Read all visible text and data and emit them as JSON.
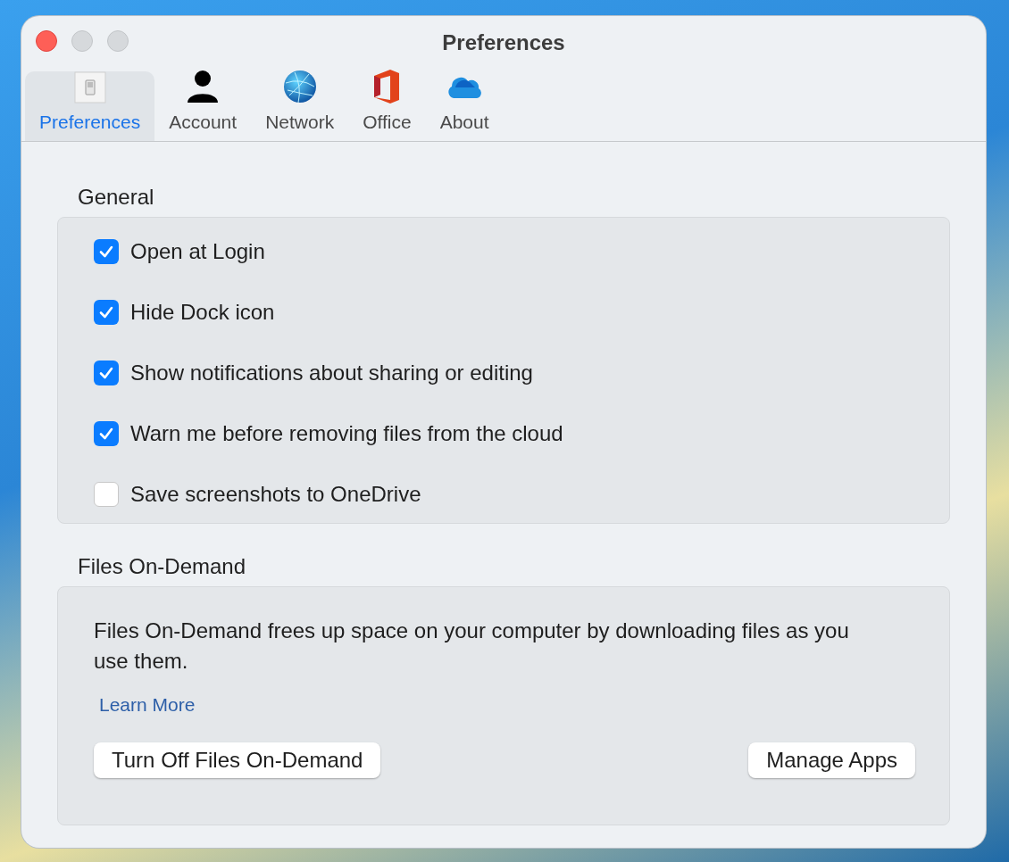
{
  "window": {
    "title": "Preferences"
  },
  "tabs": [
    {
      "label": "Preferences",
      "kind": "switch",
      "selected": true
    },
    {
      "label": "Account",
      "kind": "person",
      "selected": false
    },
    {
      "label": "Network",
      "kind": "globe",
      "selected": false
    },
    {
      "label": "Office",
      "kind": "office",
      "selected": false
    },
    {
      "label": "About",
      "kind": "cloud",
      "selected": false
    }
  ],
  "general": {
    "heading": "General",
    "options": [
      {
        "label": "Open at Login",
        "checked": true
      },
      {
        "label": "Hide Dock icon",
        "checked": true
      },
      {
        "label": "Show notifications about sharing or editing",
        "checked": true
      },
      {
        "label": "Warn me before removing files from the cloud",
        "checked": true
      },
      {
        "label": "Save screenshots to OneDrive",
        "checked": false
      }
    ]
  },
  "files_on_demand": {
    "heading": "Files On-Demand",
    "description": "Files On-Demand frees up space on your computer by downloading files as you use them.",
    "link": "Learn More",
    "buttons": [
      "Turn Off Files On-Demand",
      "Manage Apps"
    ]
  }
}
